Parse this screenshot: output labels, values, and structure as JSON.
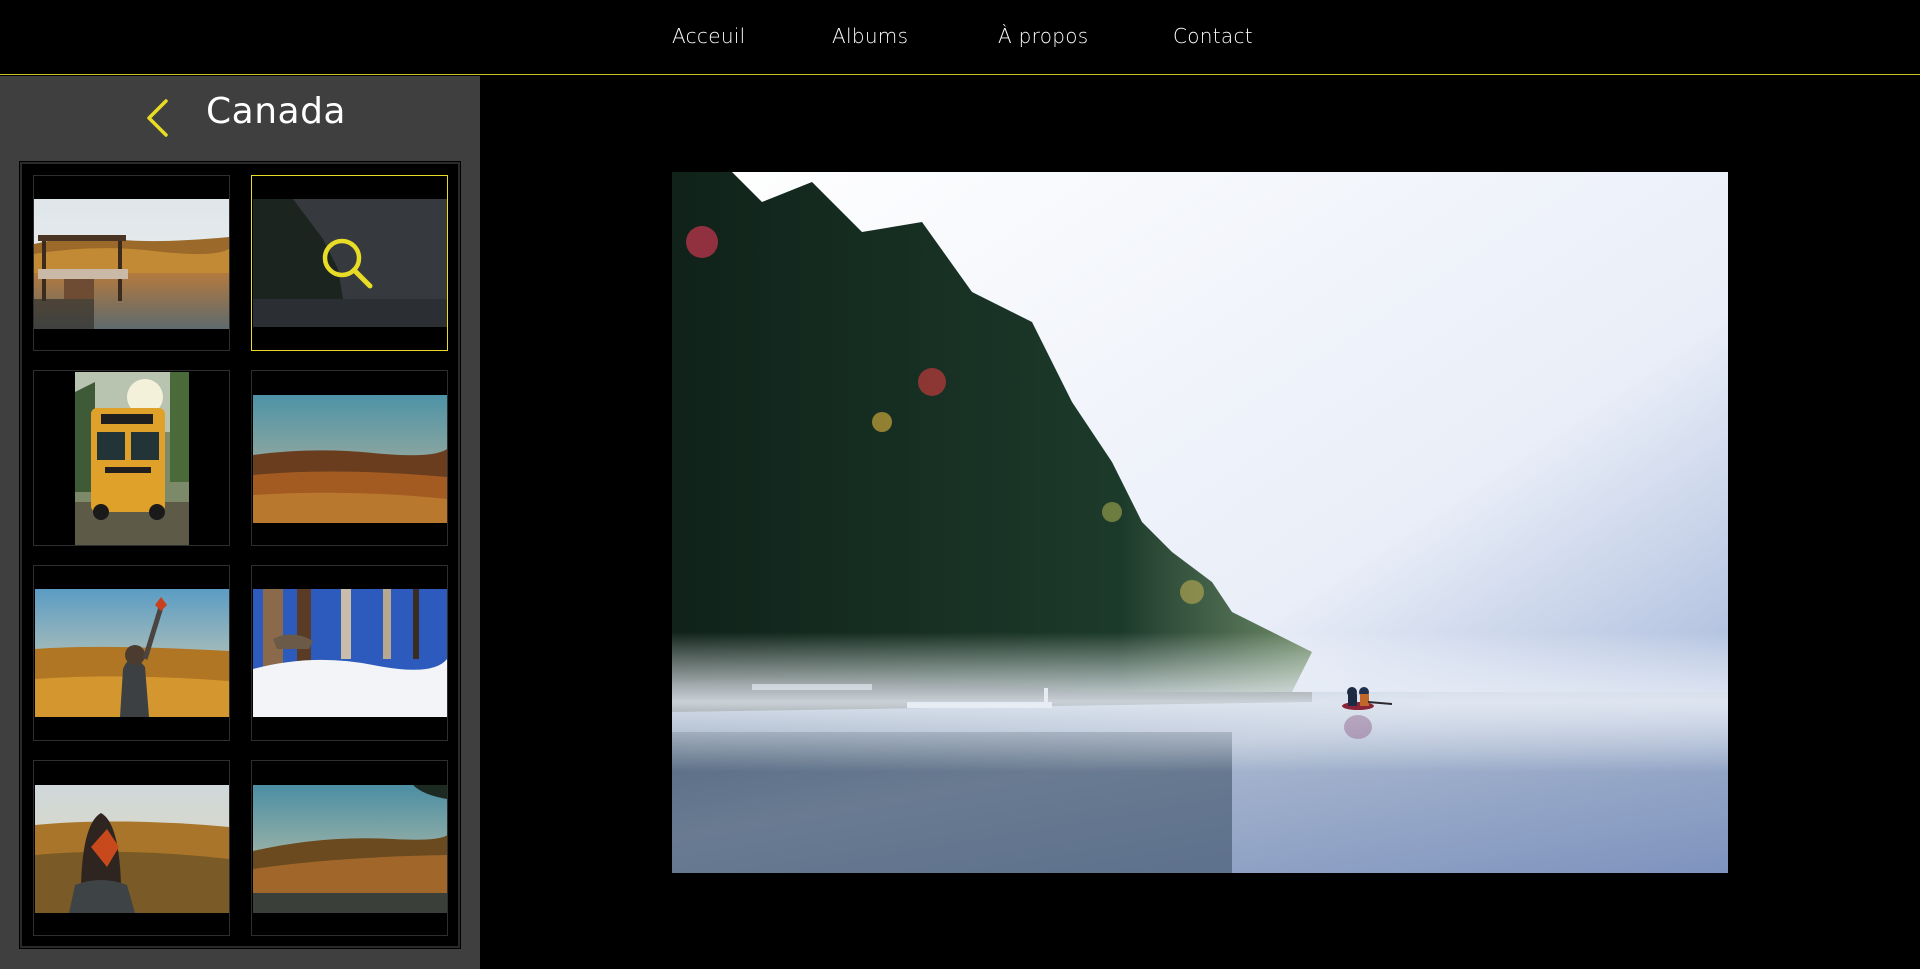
{
  "nav": {
    "items": [
      {
        "label": "Acceuil"
      },
      {
        "label": "Albums"
      },
      {
        "label": "À propos"
      },
      {
        "label": "Contact"
      }
    ]
  },
  "sidebar": {
    "album_title": "Canada",
    "back_icon": "chevron-left-icon",
    "thumbnails": [
      {
        "name": "thumb-lake-dock"
      },
      {
        "name": "thumb-misty-lake",
        "selected": true,
        "overlay_icon": "search-icon"
      },
      {
        "name": "thumb-school-bus"
      },
      {
        "name": "thumb-autumn-plain"
      },
      {
        "name": "thumb-woman-leaf"
      },
      {
        "name": "thumb-snow-forest"
      },
      {
        "name": "thumb-woman-face-leaf"
      },
      {
        "name": "thumb-autumn-lake"
      }
    ]
  },
  "main": {
    "photo": "misty-lake-canoe"
  },
  "colors": {
    "accent": "#e8dc26",
    "background": "#000000",
    "sidebar_bg": "#3f3f3f",
    "nav_border": "#c9c21f"
  }
}
